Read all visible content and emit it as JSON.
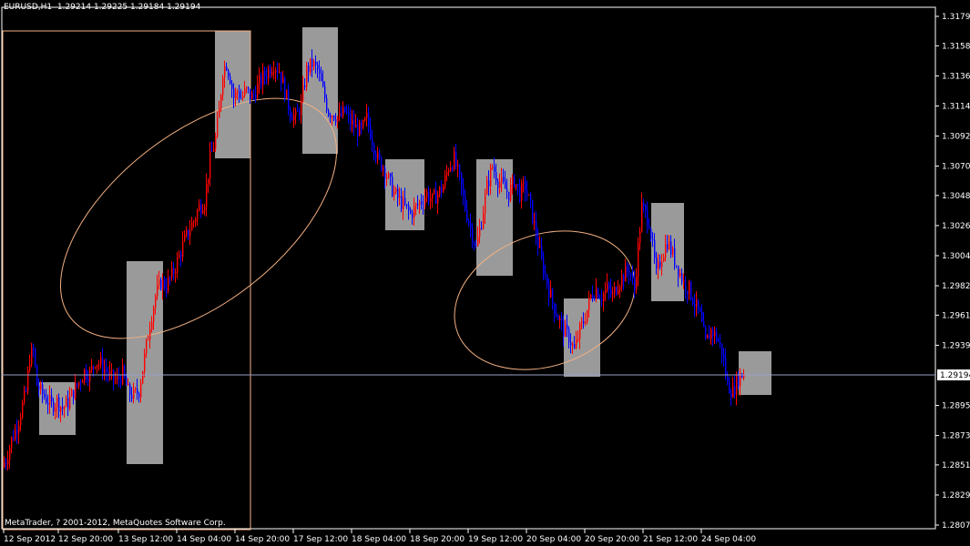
{
  "header": {
    "symbol": "EURUSD,H1",
    "ohlc": "1.29214 1.29225 1.29184 1.29194"
  },
  "footer": {
    "copyright": "MetaTrader, ? 2001-2012, MetaQuotes Software Corp."
  },
  "colors": {
    "background": "#000000",
    "axis": "#ffffff",
    "bull_candle": "#ff0000",
    "bear_candle": "#0000ff",
    "highlight_box": "#9a9a9a",
    "annotation_outline": "#f4b183",
    "bid_line": "#9aa0c8"
  },
  "chart_data": {
    "type": "candlestick",
    "symbol": "EURUSD",
    "timeframe": "H1",
    "current_price": "1.29194",
    "y_ticks": [
      "1.31795",
      "1.31580",
      "1.31360",
      "1.31140",
      "1.30920",
      "1.30700",
      "1.30485",
      "1.30265",
      "1.30045",
      "1.29825",
      "1.29610",
      "1.29390",
      "1.28950",
      "1.28730",
      "1.28515",
      "1.28295",
      "1.28075"
    ],
    "x_ticks": [
      "12 Sep 2012",
      "12 Sep 20:00",
      "13 Sep 12:00",
      "14 Sep 04:00",
      "14 Sep 20:00",
      "17 Sep 12:00",
      "18 Sep 04:00",
      "18 Sep 20:00",
      "19 Sep 12:00",
      "20 Sep 04:00",
      "20 Sep 20:00",
      "21 Sep 12:00",
      "24 Sep 04:00"
    ],
    "ylim": [
      1.28075,
      1.31795
    ],
    "close_path": [
      [
        0,
        1.285
      ],
      [
        6,
        1.2855
      ],
      [
        12,
        1.287
      ],
      [
        18,
        1.288
      ],
      [
        24,
        1.2895
      ],
      [
        28,
        1.2905
      ],
      [
        32,
        1.293
      ],
      [
        36,
        1.2935
      ],
      [
        40,
        1.291
      ],
      [
        44,
        1.2905
      ],
      [
        50,
        1.29
      ],
      [
        56,
        1.2895
      ],
      [
        62,
        1.2898
      ],
      [
        68,
        1.2893
      ],
      [
        74,
        1.2897
      ],
      [
        80,
        1.2905
      ],
      [
        86,
        1.2912
      ],
      [
        92,
        1.292
      ],
      [
        98,
        1.2918
      ],
      [
        104,
        1.2928
      ],
      [
        110,
        1.2925
      ],
      [
        116,
        1.292
      ],
      [
        122,
        1.2915
      ],
      [
        128,
        1.2913
      ],
      [
        134,
        1.2918
      ],
      [
        140,
        1.2905
      ],
      [
        146,
        1.2902
      ],
      [
        152,
        1.2906
      ],
      [
        158,
        1.293
      ],
      [
        164,
        1.2955
      ],
      [
        170,
        1.2975
      ],
      [
        176,
        1.2985
      ],
      [
        182,
        1.2983
      ],
      [
        188,
        1.299
      ],
      [
        194,
        1.3
      ],
      [
        200,
        1.3012
      ],
      [
        206,
        1.3022
      ],
      [
        212,
        1.303
      ],
      [
        218,
        1.304
      ],
      [
        224,
        1.3045
      ],
      [
        230,
        1.3075
      ],
      [
        236,
        1.309
      ],
      [
        240,
        1.311
      ],
      [
        244,
        1.314
      ],
      [
        248,
        1.3145
      ],
      [
        252,
        1.3135
      ],
      [
        256,
        1.312
      ],
      [
        260,
        1.3125
      ],
      [
        264,
        1.312
      ],
      [
        270,
        1.3125
      ],
      [
        276,
        1.312
      ],
      [
        282,
        1.3128
      ],
      [
        288,
        1.3135
      ],
      [
        294,
        1.314
      ],
      [
        300,
        1.3145
      ],
      [
        306,
        1.314
      ],
      [
        312,
        1.3125
      ],
      [
        318,
        1.311
      ],
      [
        324,
        1.3105
      ],
      [
        330,
        1.3115
      ],
      [
        336,
        1.314
      ],
      [
        342,
        1.3145
      ],
      [
        348,
        1.314
      ],
      [
        354,
        1.3125
      ],
      [
        360,
        1.311
      ],
      [
        366,
        1.3108
      ],
      [
        372,
        1.3105
      ],
      [
        378,
        1.311
      ],
      [
        384,
        1.3102
      ],
      [
        390,
        1.3098
      ],
      [
        396,
        1.3095
      ],
      [
        402,
        1.3105
      ],
      [
        408,
        1.309
      ],
      [
        414,
        1.3075
      ],
      [
        420,
        1.307
      ],
      [
        426,
        1.306
      ],
      [
        432,
        1.305
      ],
      [
        438,
        1.3045
      ],
      [
        444,
        1.304
      ],
      [
        450,
        1.3035
      ],
      [
        456,
        1.304
      ],
      [
        462,
        1.3045
      ],
      [
        468,
        1.305
      ],
      [
        474,
        1.3045
      ],
      [
        480,
        1.305
      ],
      [
        486,
        1.3055
      ],
      [
        492,
        1.307
      ],
      [
        498,
        1.3075
      ],
      [
        504,
        1.306
      ],
      [
        510,
        1.304
      ],
      [
        516,
        1.3025
      ],
      [
        522,
        1.301
      ],
      [
        528,
        1.303
      ],
      [
        534,
        1.3055
      ],
      [
        540,
        1.307
      ],
      [
        546,
        1.306
      ],
      [
        552,
        1.3055
      ],
      [
        558,
        1.305
      ],
      [
        564,
        1.306
      ],
      [
        570,
        1.305
      ],
      [
        576,
        1.3055
      ],
      [
        582,
        1.304
      ],
      [
        588,
        1.302
      ],
      [
        594,
        1.3
      ],
      [
        600,
        1.2985
      ],
      [
        606,
        1.297
      ],
      [
        612,
        1.296
      ],
      [
        618,
        1.295
      ],
      [
        624,
        1.2945
      ],
      [
        630,
        1.2935
      ],
      [
        636,
        1.295
      ],
      [
        642,
        1.296
      ],
      [
        648,
        1.2975
      ],
      [
        654,
        1.298
      ],
      [
        660,
        1.2975
      ],
      [
        666,
        1.298
      ],
      [
        672,
        1.2975
      ],
      [
        678,
        1.2985
      ],
      [
        684,
        1.299
      ],
      [
        690,
        1.2995
      ],
      [
        696,
        1.298
      ],
      [
        700,
        1.301
      ],
      [
        704,
        1.304
      ],
      [
        708,
        1.3035
      ],
      [
        712,
        1.303
      ],
      [
        716,
        1.301
      ],
      [
        720,
        1.299
      ],
      [
        726,
        1.3005
      ],
      [
        732,
        1.3015
      ],
      [
        738,
        1.3005
      ],
      [
        744,
        1.2995
      ],
      [
        750,
        1.2985
      ],
      [
        756,
        1.298
      ],
      [
        762,
        1.297
      ],
      [
        768,
        1.296
      ],
      [
        774,
        1.294
      ],
      [
        780,
        1.295
      ],
      [
        786,
        1.2945
      ],
      [
        792,
        1.2935
      ],
      [
        798,
        1.291
      ],
      [
        804,
        1.2905
      ],
      [
        810,
        1.2915
      ],
      [
        816,
        1.2919
      ]
    ]
  }
}
